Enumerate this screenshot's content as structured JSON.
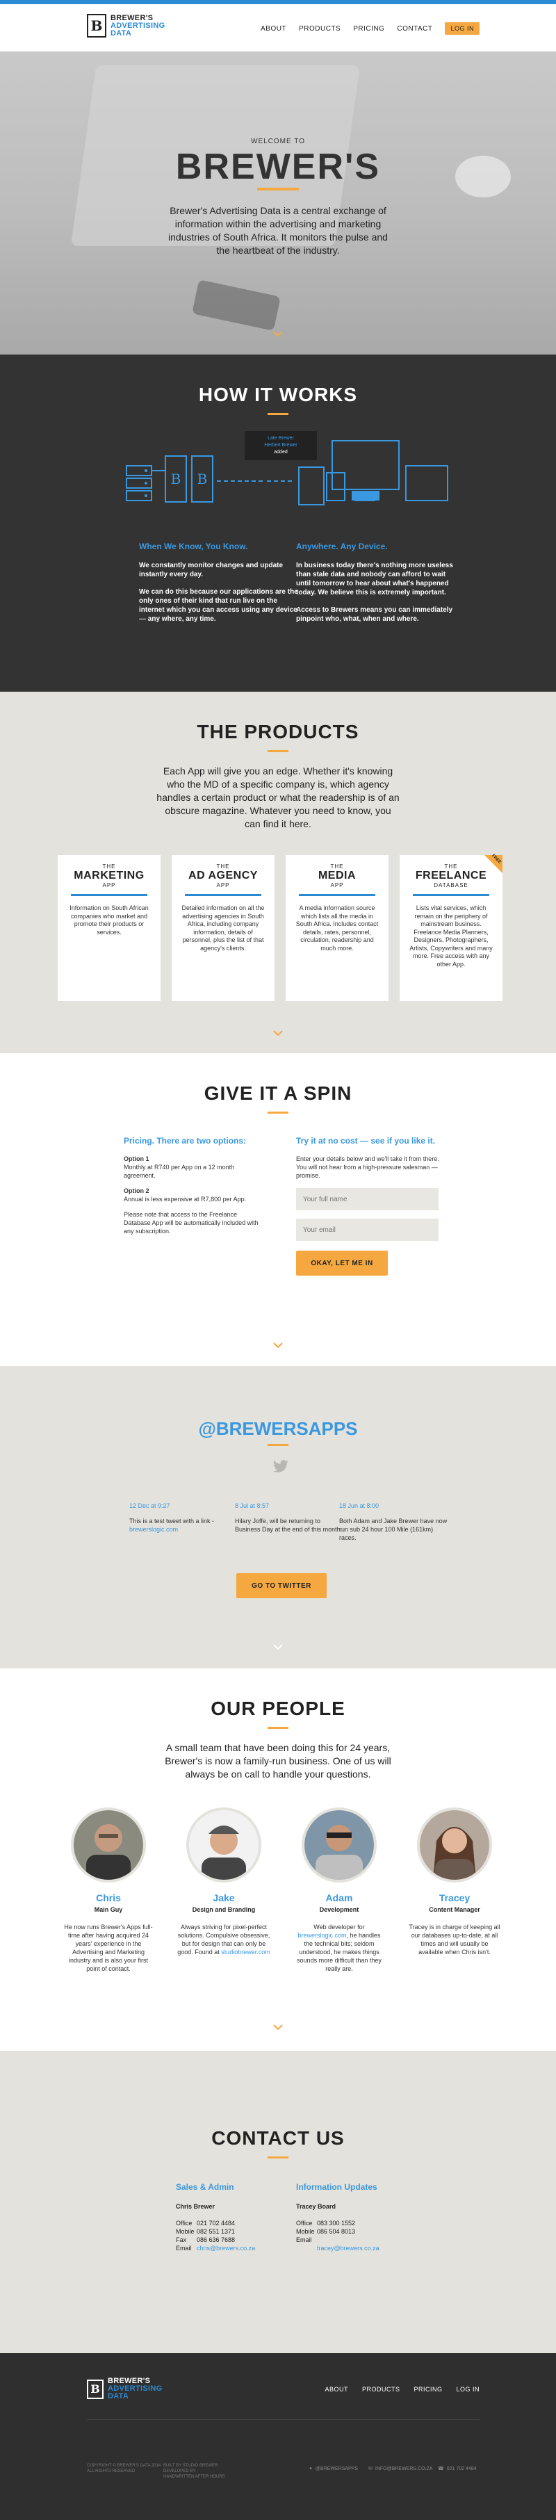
{
  "header": {
    "logo_letter": "B",
    "logo_line1": "BREWER'S",
    "logo_line2": "ADVERTISING",
    "logo_line3": "DATA",
    "nav": [
      "ABOUT",
      "PRODUCTS",
      "PRICING",
      "CONTACT"
    ],
    "login": "LOG IN"
  },
  "hero": {
    "welcome": "WELCOME TO",
    "brand": "BREWER'S",
    "description": "Brewer's Advertising Data is a central exchange of information within the advertising and marketing industries of South Africa. It monitors the pulse and the heartbeat of the industry."
  },
  "how": {
    "title": "HOW IT WORKS",
    "tooltip_line1": "Late Brewer",
    "tooltip_line2": "Herbert Brewer",
    "tooltip_line3": "added",
    "left_heading": "When We Know, You Know.",
    "left_p1": "We constantly monitor changes and update instantly every day.",
    "left_p2": "We can do this because our applications are the only ones of their kind that run live on the internet which you can access using any device — any where, any time.",
    "right_heading": "Anywhere. Any Device.",
    "right_p1": "In business today there's nothing more useless than stale data and nobody can afford to wait until tomorrow to hear about what's happened today. We believe this is extremely important.",
    "right_p2": "Access to Brewers means you can immediately pinpoint who, what, when and where."
  },
  "products": {
    "title": "THE PRODUCTS",
    "intro": "Each App will give you an edge. Whether it's knowing who the MD of a specific company is, which agency handles a certain product or what the readership is of an obscure magazine. Whatever you need to know, you can find it here.",
    "cards": [
      {
        "the": "THE",
        "name": "MARKETING",
        "sub": "APP",
        "desc": "Information on South African companies who market and promote their products or services."
      },
      {
        "the": "THE",
        "name": "AD AGENCY",
        "sub": "APP",
        "desc": "Detailed information on all the advertising agencies in South Africa, including company information, details of personnel, plus the list of that agency's clients."
      },
      {
        "the": "THE",
        "name": "MEDIA",
        "sub": "APP",
        "desc": "A media information source which lists all the media in South Africa. Includes contact details, rates, personnel, circulation, readership and much more."
      },
      {
        "the": "THE",
        "name": "FREELANCE",
        "sub": "DATABASE",
        "desc": "Lists vital services, which remain on the periphery of mainstream business. Freelance Media Planners, Designers, Photographers, Artists, Copywriters and many more. Free access with any other App.",
        "ribbon": "FREE"
      }
    ]
  },
  "spin": {
    "title": "GIVE IT A SPIN",
    "left_heading": "Pricing. There are two options:",
    "opt1_title": "Option 1",
    "opt1_text": "Monthly at R740 per App on a 12 month agreement.",
    "opt2_title": "Option 2",
    "opt2_text": "Annual is less expensive at R7,800 per App.",
    "note": "Please note that access to the Freelance Database App will be automatically included with any subscription.",
    "right_heading": "Try it at no cost — see if you like it.",
    "right_text": "Enter your details below and we'll take it from there. You will not hear from a high-pressure salesman — promise.",
    "name_placeholder": "Your full name",
    "email_placeholder": "Your email",
    "button": "OKAY, LET ME IN"
  },
  "twitter": {
    "handle": "@BREWERSAPPS",
    "tweets": [
      {
        "date": "12 Dec at 9:27",
        "text": "This is a test tweet with a link -",
        "link": "brewerslogic.com"
      },
      {
        "date": "8 Jul at 8:57",
        "text": "Hilary Joffe, will be returning to Business Day at the end of this month."
      },
      {
        "date": "18 Jun at 8:00",
        "text": "Both Adam and Jake Brewer have now run sub 24 hour 100 Mile (161km) races."
      }
    ],
    "button": "GO TO TWITTER"
  },
  "people": {
    "title": "OUR PEOPLE",
    "intro": "A small team that have been doing this for 24 years, Brewer's is now a family-run business. One of us will always be on call to handle your questions.",
    "members": [
      {
        "name": "Chris",
        "role": "Main Guy",
        "bio": "He now runs Brewer's Apps full-time after having acquired 24 years' experience in the Advertising and Marketing industry and is also your first point of contact."
      },
      {
        "name": "Jake",
        "role": "Design and Branding",
        "bio": "Always striving for pixel-perfect solutions. Compulsive obsessive, but for design that can only be good. Found at",
        "link": "studiobrewer.com"
      },
      {
        "name": "Adam",
        "role": "Development",
        "bio": "Web developer for",
        "link": "brewerslogic.com",
        "bio2": ", he handles the technical bits; seldom understood, he makes things sounds more difficult than they really are."
      },
      {
        "name": "Tracey",
        "role": "Content Manager",
        "bio": "Tracey is in charge of keeping all our databases up-to-date, at all times and will usually be available when Chris isn't."
      }
    ]
  },
  "contact": {
    "title": "CONTACT US",
    "sales_heading": "Sales & Admin",
    "sales_name": "Chris Brewer",
    "sales_rows": [
      {
        "k": "Office",
        "v": "021 702 4484"
      },
      {
        "k": "Mobile",
        "v": "082 551 1371"
      },
      {
        "k": "Fax",
        "v": "086 636 7688"
      },
      {
        "k": "Email",
        "v": "chris@brewers.co.za",
        "link": true
      }
    ],
    "info_heading": "Information Updates",
    "info_name": "Tracey Board",
    "info_rows": [
      {
        "k": "Office",
        "v": "083 300 1552"
      },
      {
        "k": "Mobile",
        "v": "086 504 8013"
      },
      {
        "k": "Email",
        "v": ""
      },
      {
        "k": "",
        "v": "tracey@brewers.co.za",
        "link": true
      }
    ]
  },
  "footer": {
    "nav": [
      "ABOUT",
      "PRODUCTS",
      "PRICING",
      "LOG IN"
    ],
    "copy1": "COPYRIGHT © BREWER'S DATA 2014",
    "copy2": "ALL RIGHTS RESERVED",
    "built1": "BUILT BY STUDIO BREWER",
    "built2": "DEVELOPED BY",
    "built3": "HANDWRITTEN AFTER HOURS",
    "social1": "@BREWERSAPPS",
    "social2": "INFO@BREWERS.CO.ZA",
    "social3": "021 702 4484"
  },
  "colors": {
    "accent": "#f6a840",
    "brand": "#2a8ad4",
    "dark": "#333333",
    "beige": "#e4e2dc"
  }
}
